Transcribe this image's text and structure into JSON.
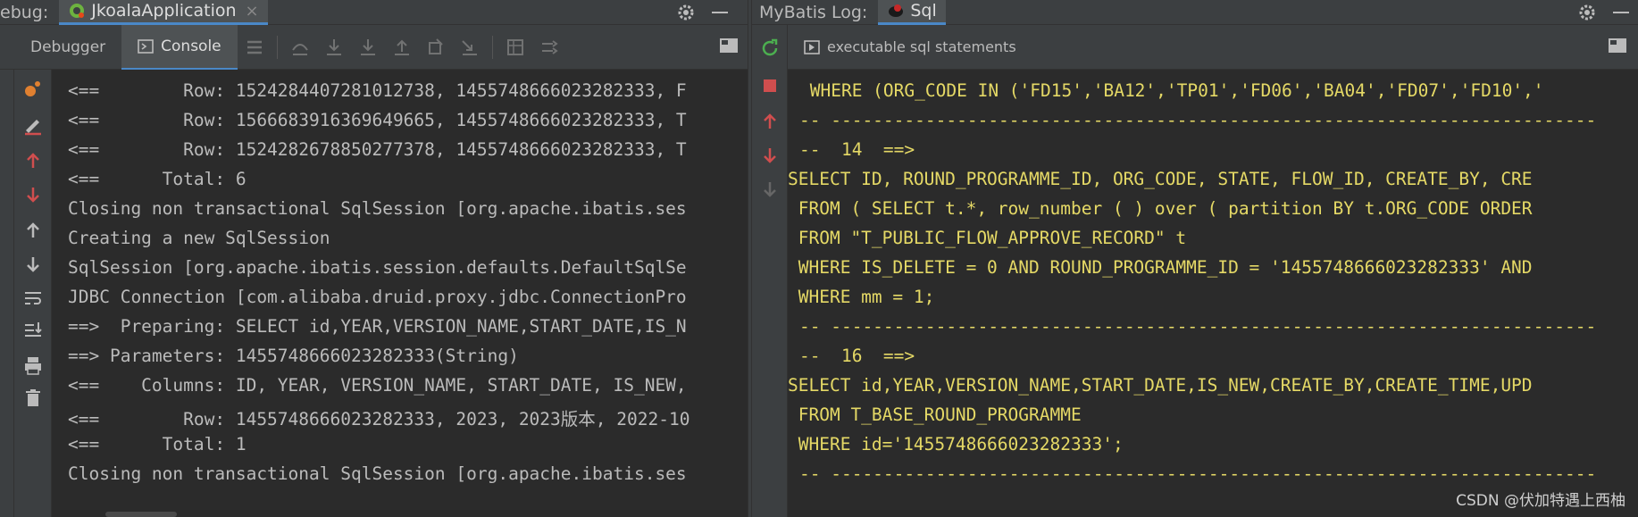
{
  "left": {
    "title_prefix": "ebug:",
    "run_tab": "JkoalaApplication",
    "close_glyph": "×",
    "subtabs": [
      "Debugger",
      "Console"
    ],
    "lines": [
      "<==        Row: 1524284407281012738, 1455748666023282333, F",
      "<==        Row: 1566683916369649665, 1455748666023282333, T",
      "<==        Row: 1524282678850277378, 1455748666023282333, T",
      "<==      Total: 6",
      "Closing non transactional SqlSession [org.apache.ibatis.ses",
      "Creating a new SqlSession",
      "SqlSession [org.apache.ibatis.session.defaults.DefaultSqlSe",
      "JDBC Connection [com.alibaba.druid.proxy.jdbc.ConnectionPro",
      "==>  Preparing: SELECT id,YEAR,VERSION_NAME,START_DATE,IS_N",
      "==> Parameters: 1455748666023282333(String)",
      "<==    Columns: ID, YEAR, VERSION_NAME, START_DATE, IS_NEW,",
      "<==        Row: 1455748666023282333, 2023, 2023版本, 2022-10",
      "<==      Total: 1",
      "Closing non transactional SqlSession [org.apache.ibatis.ses"
    ]
  },
  "right": {
    "title_prefix": "MyBatis Log:",
    "tab": "Sql",
    "toolbar_label": "executable sql statements",
    "lines": [
      " WHERE (ORG_CODE IN ('FD15','BA12','TP01','FD06','BA04','FD07','FD10','",
      "-- -------------------------------------------------------------------------",
      "--  14  ==>",
      "SELECT ID, ROUND_PROGRAMME_ID, ORG_CODE, STATE, FLOW_ID, CREATE_BY, CRE",
      " FROM ( SELECT t.*, row_number ( ) over ( partition BY t.ORG_CODE ORDER",
      " FROM \"T_PUBLIC_FLOW_APPROVE_RECORD\" t",
      " WHERE IS_DELETE = 0 AND ROUND_PROGRAMME_ID = '1455748666023282333' AND",
      " WHERE mm = 1;",
      "-- -------------------------------------------------------------------------",
      "--  16  ==>",
      "SELECT id,YEAR,VERSION_NAME,START_DATE,IS_NEW,CREATE_BY,CREATE_TIME,UPD",
      " FROM T_BASE_ROUND_PROGRAMME",
      " WHERE id='1455748666023282333';",
      "-- -------------------------------------------------------------------------"
    ],
    "watermark": "CSDN @伏加特遇上西柚"
  },
  "colors": {
    "sql_text": "#e5d966",
    "console_text": "#bbbbbb",
    "red_icon": "#d04e4e",
    "green_icon": "#4caf50",
    "accent": "#4a88c7"
  }
}
